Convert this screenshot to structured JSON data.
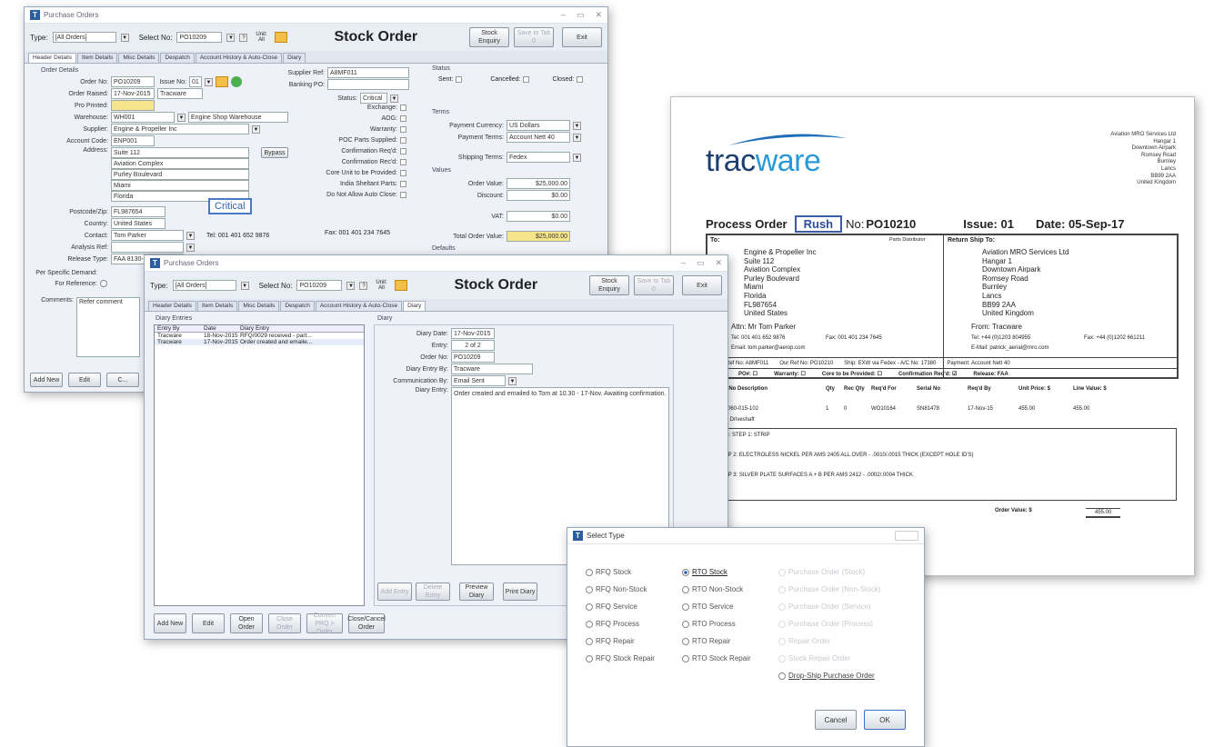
{
  "win1": {
    "title": "Purchase Orders",
    "type_label": "Type:",
    "type_value": "[All Orders]",
    "select_label": "Select No:",
    "select_value": "PO10209",
    "unit_label": "Unit: All",
    "heading": "Stock Order",
    "btn_stock_enquiry": "Stock Enquiry",
    "btn_save_to_tab": "Save to Tab 0",
    "btn_exit": "Exit",
    "tabs": [
      "Header Details",
      "Item Details",
      "Misc Details",
      "Despatch",
      "Account History & Auto-Close",
      "Diary"
    ],
    "section_order": "Order Details",
    "order_no_label": "Order No:",
    "order_no": "PO10209",
    "issue_no_label": "Issue No:",
    "issue_no": "01",
    "order_raised_label": "Order Raised:",
    "order_raised_date": "17-Nov-2015",
    "order_raised_by": "Tracware",
    "pro_printed_label": "Pro Printed:",
    "warehouse_label": "Warehouse:",
    "warehouse_code": "WH001",
    "warehouse_name": "Engine Shop Warehouse",
    "supplier_label": "Supplier:",
    "supplier": "Engine & Propeller Inc",
    "account_code_label": "Account Code:",
    "account_code": "ENP001",
    "address_label": "Address:",
    "address_lines": [
      "Suite 112",
      "Aviation Complex",
      "Purley Boulevard",
      "Miami",
      "Florida"
    ],
    "bypass_label": "Bypass",
    "postcode_label": "Postcode/Zip:",
    "postcode": "FL987654",
    "country_label": "Country:",
    "country": "United States",
    "contact_label": "Contact:",
    "contact": "Tom Parker",
    "tel_fax": "Tel: 001 401 652 9876",
    "analysis_label": "Analysis Ref:",
    "release_label": "Release Type:",
    "release": "FAA 8130-3",
    "critical": "Critical",
    "supplier_ref_label": "Supplier Ref:",
    "supplier_ref": "A8MF011",
    "banking_label": "Banking PO:",
    "status_label": "Status:",
    "status_value": "Critical",
    "exchange_label": "Exchange:",
    "aog_label": "AOG:",
    "warranty_label": "Warranty:",
    "poc_label": "POC Parts Supplied:",
    "confirm_label": "Confirmation Req'd:",
    "confirmation_label": "Confirmation Rec'd:",
    "core_label": "Core Unit to be Provided:",
    "india_label": "India Sheltant Parts:",
    "no_not_label": "Do Not Allow Auto Close:",
    "fax_label": "Fax: 001 401 234 7645",
    "status_group": "Status",
    "sent_label": "Sent:",
    "cancelled_label": "Cancelled:",
    "closed_label": "Closed:",
    "terms_group": "Terms",
    "pay_currency_label": "Payment Currency:",
    "pay_currency": "US Dollars",
    "pay_terms_label": "Payment Terms:",
    "pay_terms": "Account Nett 40",
    "ship_terms_label": "Shipping Terms:",
    "ship_terms": "Fedex",
    "values_group": "Values",
    "order_value_label": "Order Value:",
    "order_value": "$25,000.00",
    "discount_label": "Discount:",
    "discount": "$0.00",
    "vat_label": "VAT:",
    "vat": "$0.00",
    "total_label": "Total Order Value:",
    "total": "$25,000.00",
    "defaults_group": "Defaults",
    "specific_label": "Per Specific Demand:",
    "reference_label": "For Reference:",
    "comments_label": "Comments:",
    "comments": "Refer comment",
    "btn_add": "Add New",
    "btn_edit": "Edit",
    "btn_c": "C..."
  },
  "win2": {
    "title": "Purchase Orders",
    "type_label": "Type:",
    "type_value": "[All Orders]",
    "select_label": "Select No:",
    "select_value": "PO10209",
    "unit_label": "Unit: All",
    "heading": "Stock Order",
    "btn_stock_enquiry": "Stock Enquiry",
    "btn_save_to_tab": "Save to Tab 0",
    "btn_exit": "Exit",
    "tabs": [
      "Header Details",
      "Item Details",
      "Misc Details",
      "Despatch",
      "Account History & Auto-Close",
      "Diary"
    ],
    "diary_entries": "Diary Entries",
    "cols": [
      "Entry By",
      "Date",
      "Diary Entry"
    ],
    "rows": [
      [
        "Tracware",
        "18-Nov-2015",
        "RFQ/0029 received - part..."
      ],
      [
        "Tracware",
        "17-Nov-2015",
        "Order created and emaile..."
      ]
    ],
    "diary_group": "Diary",
    "diary_date_label": "Diary Date:",
    "diary_date": "17-Nov-2015",
    "entry_label": "Entry:",
    "entry": "2 of 2",
    "order_no_label": "Order No:",
    "order_no": "PO10209",
    "entry_by_label": "Diary Entry By:",
    "entry_by": "Tracware",
    "comm_label": "Communication By:",
    "comm": "Email Sent",
    "diary_entry_label": "Diary Entry:",
    "diary_text": "Order created and emailed to Tom at 10.30 - 17-Nov. Awaiting confirmation.",
    "btn_add_entry": "Add Entry",
    "btn_delete_entry": "Delete Entry",
    "btn_preview_diary": "Preview Diary",
    "btn_print_diary": "Print Diary",
    "btn_add": "Add New",
    "btn_edit": "Edit",
    "btn_open_order": "Open Order",
    "btn_close_order": "Close Order",
    "btn_convert": "Convert PRQ > Order",
    "btn_close_cancel": "Close/Cancel Order"
  },
  "paper": {
    "logo_a": "trac",
    "logo_b": "ware",
    "company_address": [
      "Aviation MRO Services Ltd",
      "Hangar 1",
      "Downtown Airpark",
      "Romsey Road",
      "Burnley",
      "Lancs",
      "BB99 2AA",
      "United Kingdom"
    ],
    "doc_title": "Process Order",
    "rush": "Rush",
    "no_label": "No:",
    "po_number": "PO10210",
    "issue": "Issue: 01",
    "date": "Date: 05-Sep-17",
    "to_label": "To:",
    "parts_distributor": "Parts Distributor",
    "to_address": [
      "Engine & Propeller Inc",
      "Suite 112",
      "Aviation Complex",
      "Purley Boulevard",
      "Miami",
      "Florida",
      "FL987654",
      "United States"
    ],
    "return_label": "Return Ship To:",
    "return_address": [
      "Aviation MRO Services Ltd",
      "Hangar 1",
      "Downtown Airpark",
      "Romsey Road",
      "Burnley",
      "Lancs",
      "BB99 2AA",
      "United Kingdom"
    ],
    "attn": "Attn: Mr Tom Parker",
    "from": "From: Tracware",
    "tel": "Tel: 001 401 652 9876",
    "fax": "Fax: 001 401 234 7645",
    "email": "Email: tom.parker@aerop.com",
    "tel2": "Tel: +44 (0)1203 804955",
    "fax2": "Fax: +44 (0)1202 661211",
    "email2": "E-Mail: patrick_aerial@mro.com",
    "ref_row": [
      "Ref No: A8MF011",
      "Our Ref No: PO10210",
      "Ship: EXW via Fedex - A/C No: 17380",
      "Payment: Account Nett 40"
    ],
    "check_row": [
      "PO#: ☐",
      "Warranty: ☐",
      "Core to be Provided: ☐",
      "Confirmation Req'd: ☑",
      "Release: FAA"
    ],
    "item_headers": [
      "Part No Description",
      "Qty",
      "Rec Qty",
      "Req'd For",
      "Serial No",
      "Req'd By",
      "Unit Price: $",
      "Line Value: $"
    ],
    "item_row": [
      "336-060-015-102",
      "1",
      "0",
      "WO10164",
      "SN81478",
      "17-Nov-15",
      "455.00",
      "455.00"
    ],
    "item_desc": "Main Driveshaft",
    "notes": [
      "Note: STEP 1: STRIP",
      "STEP 2: ELECTROLESS NICKEL PER AMS 2405 ALL OVER - .0010/.0015 THICK (EXCEPT HOLE ID'S)",
      "STEP 3: SILVER PLATE SURFACES A + B PER AMS 2412 - .0002/.0004 THICK"
    ],
    "order_value_label": "Order Value: $",
    "order_value": "455.00"
  },
  "dialog": {
    "title": "Select Type",
    "col1": [
      "RFQ Stock",
      "RFQ Non-Stock",
      "RFQ Service",
      "RFQ Process",
      "RFQ Repair",
      "RFQ Stock Repair"
    ],
    "col2": [
      "RTO Stock",
      "RTO Non-Stock",
      "RTO Service",
      "RTO Process",
      "RTO Repair",
      "RTO Stock Repair"
    ],
    "col3": [
      "Purchase Order (Stock)",
      "Purchase Order (Non-Stock)",
      "Purchase Order (Service)",
      "Purchase Order (Process)",
      "Repair Order",
      "Stock Repair Order"
    ],
    "dropship": "Drop-Ship Purchase Order",
    "cancel": "Cancel",
    "ok": "OK"
  }
}
